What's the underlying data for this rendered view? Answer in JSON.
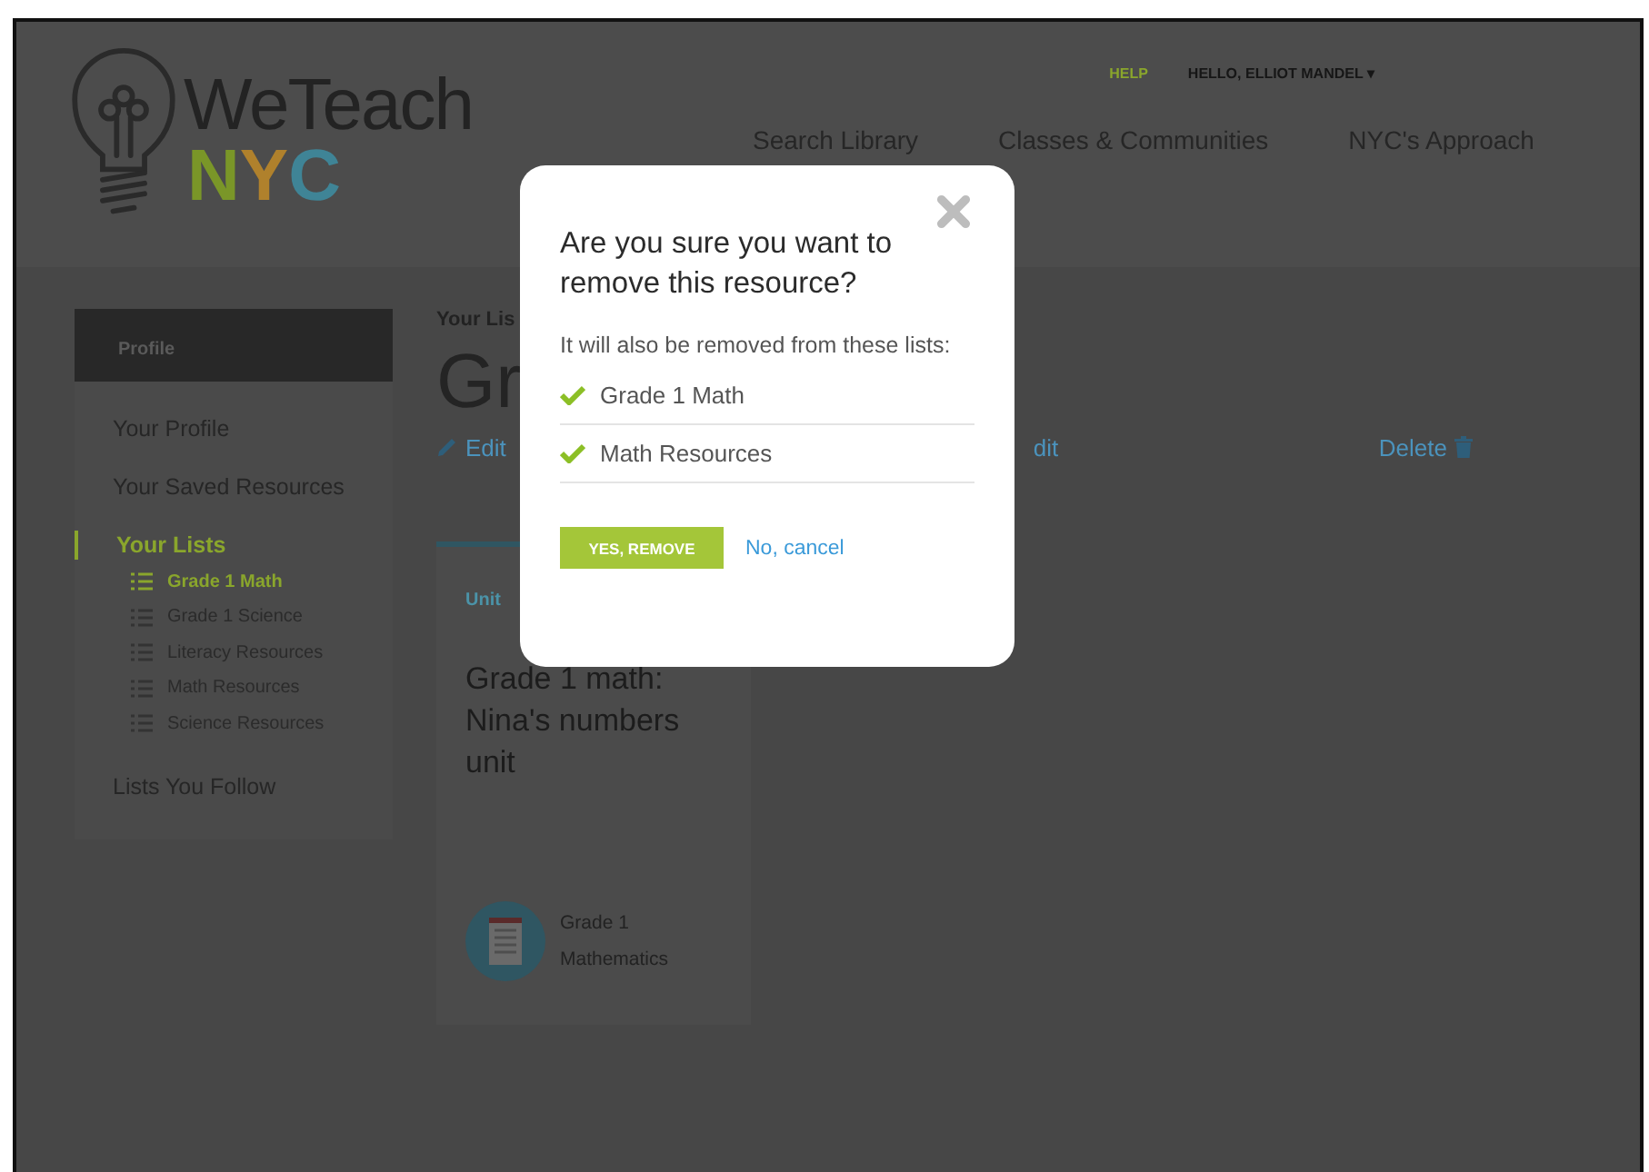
{
  "logo": {
    "wordmark": "WeTeach",
    "letters": [
      {
        "text": "N",
        "color": "#7a9628"
      },
      {
        "text": "Y",
        "color": "#b0812c"
      },
      {
        "text": "C",
        "color": "#3f8496"
      }
    ]
  },
  "top_links": [
    {
      "label": "HELP",
      "kind": "help"
    },
    {
      "label": "HELLO,  ELLIOT MANDEL ▾",
      "kind": "user"
    }
  ],
  "nav": [
    "Search Library",
    "Classes & Communities",
    "NYC's Approach"
  ],
  "sidebar": {
    "header": "Profile",
    "items": [
      {
        "label": "Your Profile",
        "selected": false
      },
      {
        "label": "Your Saved Resources",
        "selected": false
      },
      {
        "label": "Your Lists",
        "selected": true,
        "children": [
          {
            "label": "Grade 1 Math",
            "selected": true
          },
          {
            "label": "Grade 1 Science",
            "selected": false
          },
          {
            "label": "Literacy Resources",
            "selected": false
          },
          {
            "label": "Math Resources",
            "selected": false
          },
          {
            "label": "Science Resources",
            "selected": false
          }
        ]
      },
      {
        "label": "Lists You Follow",
        "selected": false
      }
    ]
  },
  "main": {
    "breadcrumb": "Your Lis",
    "heading": "Gr",
    "actions": [
      {
        "label": "Edit",
        "kind": "edit"
      },
      {
        "label": "dit",
        "kind": "cut"
      },
      {
        "label": "Delete",
        "kind": "delete"
      }
    ],
    "card": {
      "type": "Unit",
      "title": "Grade 1 math: Nina's numbers unit",
      "meta": [
        "Grade 1",
        "Mathematics"
      ]
    }
  },
  "dialog": {
    "title": "Are you sure you want to remove this resource?",
    "message": "It will also be removed from these lists:",
    "lists": [
      "Grade 1 Math",
      "Math Resources"
    ],
    "confirm": "YES, REMOVE",
    "cancel": "No, cancel"
  }
}
